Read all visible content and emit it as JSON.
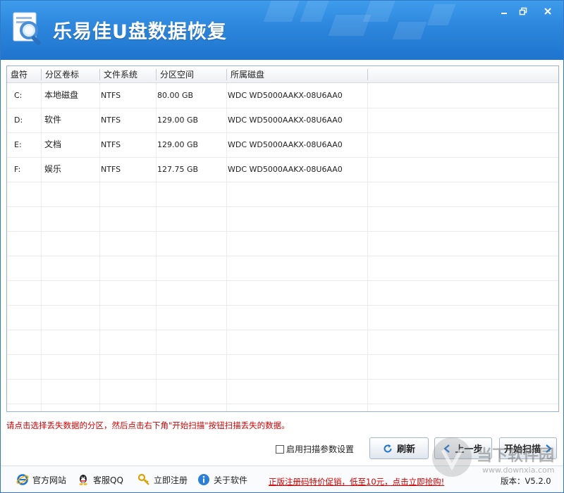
{
  "app": {
    "title": "乐易佳U盘数据恢复"
  },
  "table": {
    "headers": [
      "盘符",
      "分区卷标",
      "文件系统",
      "分区空间",
      "所属磁盘"
    ],
    "rows": [
      {
        "drive": "C:",
        "label": "本地磁盘",
        "fs": "NTFS",
        "size": "80.00 GB",
        "disk": "WDC WD5000AAKX-08U6AA0"
      },
      {
        "drive": "D:",
        "label": "软件",
        "fs": "NTFS",
        "size": "129.00 GB",
        "disk": "WDC WD5000AAKX-08U6AA0"
      },
      {
        "drive": "E:",
        "label": "文档",
        "fs": "NTFS",
        "size": "129.00 GB",
        "disk": "WDC WD5000AAKX-08U6AA0"
      },
      {
        "drive": "F:",
        "label": "娱乐",
        "fs": "NTFS",
        "size": "127.75 GB",
        "disk": "WDC WD5000AAKX-08U6AA0"
      }
    ]
  },
  "hint": "请点击选择丢失数据的分区，然后点击右下角\"开始扫描\"按钮扫描丢失的数据。",
  "controls": {
    "scan_params_label": "启用扫描参数设置",
    "refresh_label": "刷新",
    "prev_label": "上一步",
    "start_label": "开始扫描"
  },
  "footer": {
    "website": "官方网站",
    "qq": "客服QQ",
    "register": "立即注册",
    "about": "关于软件",
    "promo": "正版注册码特价促销，低至10元，点击立即抢购!",
    "version_label": "版本：",
    "version": "V5.2.0"
  },
  "colors": {
    "titlebar": "#2c86dc",
    "hint_red": "#d40000"
  },
  "watermark": {
    "text1": "当下软件园",
    "text2": "www.downxia.com"
  }
}
